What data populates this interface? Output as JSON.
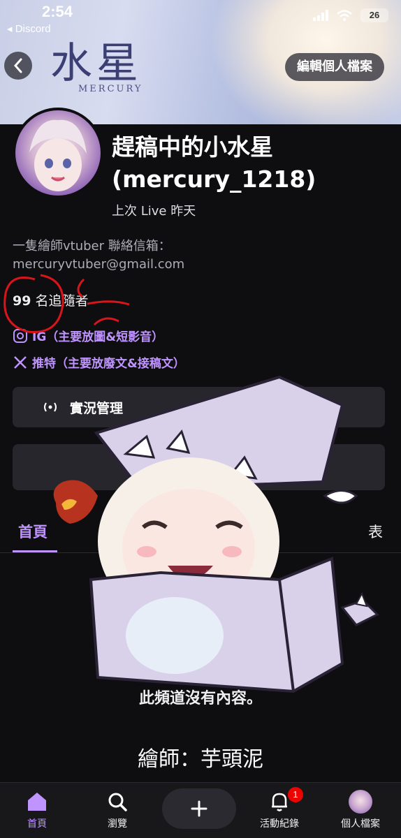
{
  "status_bar": {
    "time": "2:54",
    "back_app": "◂ Discord",
    "battery": "26"
  },
  "banner": {
    "logo_kanji": "水星",
    "logo_sub": "MERCURY",
    "edit_profile_label": "編輯個人檔案"
  },
  "profile": {
    "display_name": "趕稿中的小水星",
    "username": "(mercury_1218)",
    "last_live": "上次 Live 昨天",
    "bio_line1": "一隻繪師vtuber 聯絡信箱：",
    "bio_line2": "mercuryvtuber@gmail.com",
    "follower_count": "99",
    "follower_label": " 名追隨者",
    "links": [
      {
        "label": "IG（主要放圖&短影音）"
      },
      {
        "label": "推特（主要放廢文&接稿文）"
      }
    ]
  },
  "buttons": {
    "live_manager": "實況管理"
  },
  "tabs": {
    "home": "首頁",
    "right_partial": "表"
  },
  "content": {
    "empty_message": "此頻道沒有內容。",
    "artist_credit": "繪師：芋頭泥"
  },
  "tabbar": {
    "home": "首頁",
    "browse": "瀏覽",
    "activity": "活動紀錄",
    "activity_badge": "1",
    "profile": "個人檔案"
  },
  "colors": {
    "accent": "#bf94ff",
    "background": "#0e0e10",
    "annotation": "#d8151b"
  }
}
